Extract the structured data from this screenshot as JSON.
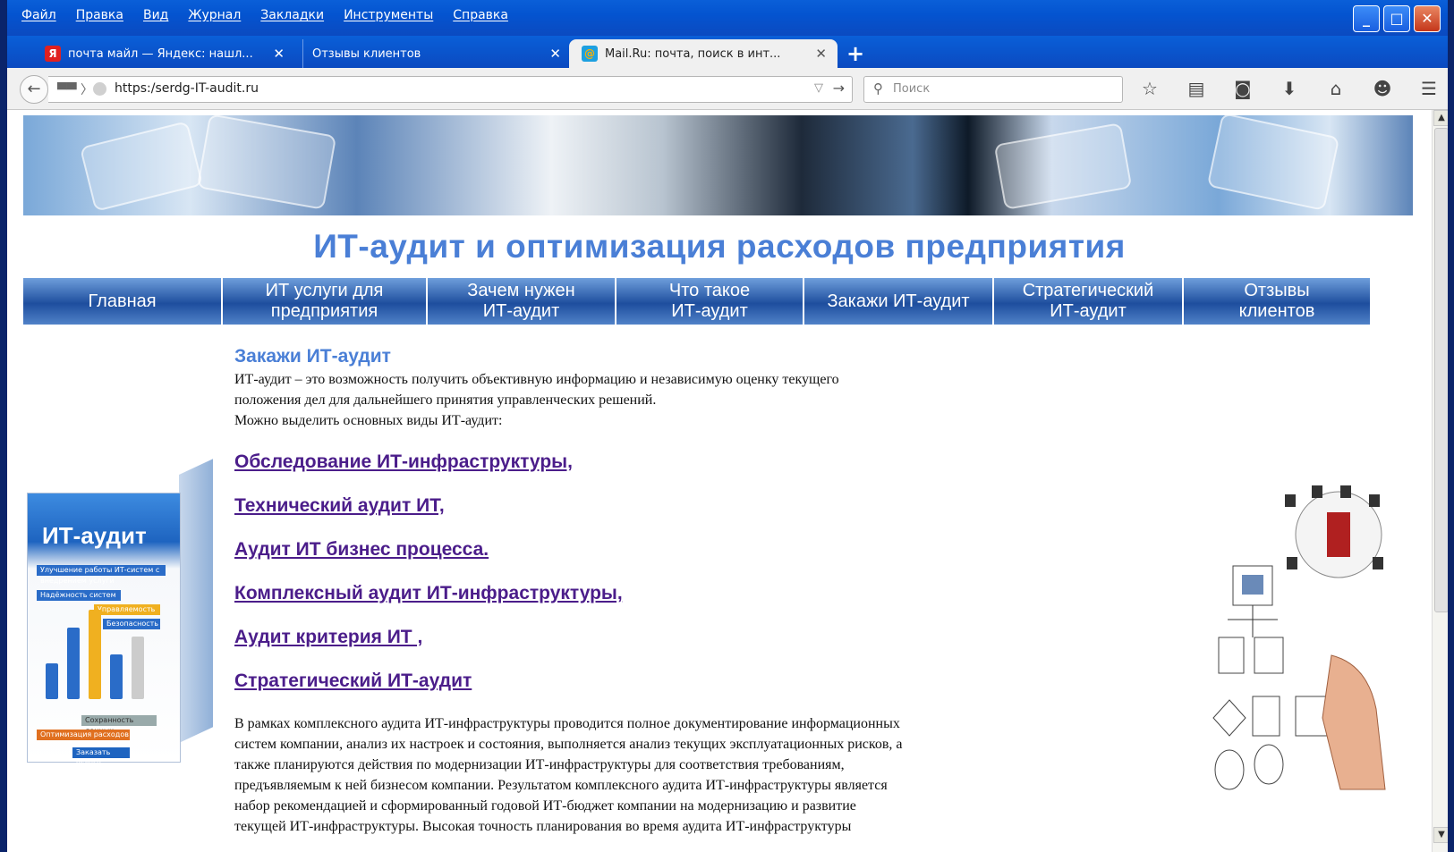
{
  "menu": [
    "Файл",
    "Правка",
    "Вид",
    "Журнал",
    "Закладки",
    "Инструменты",
    "Справка"
  ],
  "tabs": [
    {
      "label": "почта майл — Яндекс: нашл...",
      "favicon": "Я"
    },
    {
      "label": "Отзывы клиентов",
      "favicon": ""
    },
    {
      "label": "Mail.Ru: почта, поиск в инт...",
      "favicon": "@"
    }
  ],
  "navbar": {
    "url": "https:/serdg-IT-audit.ru",
    "search_placeholder": "Поиск"
  },
  "page": {
    "title": "ИТ-аудит и оптимизация расходов предприятия",
    "nav": [
      {
        "l1": "Главная",
        "l2": ""
      },
      {
        "l1": "ИТ услуги для",
        "l2": "предприятия"
      },
      {
        "l1": "Зачем нужен",
        "l2": "ИТ-аудит"
      },
      {
        "l1": "Что такое",
        "l2": "ИТ-аудит"
      },
      {
        "l1": "Закажи ИТ-аудит",
        "l2": ""
      },
      {
        "l1": "Стратегический",
        "l2": "ИТ-аудит"
      },
      {
        "l1": "Отзывы",
        "l2": "клиентов"
      }
    ],
    "section_title": "Закажи ИТ-аудит",
    "intro": [
      "ИТ-аудит – это возможность получить объективную информацию и независимую оценку текущего",
      "положения дел для дальнейшего принятия управленческих решений.",
      "Можно выделить основных виды ИТ-аудит:"
    ],
    "links": [
      "Обследование ИТ-инфраструктуры,",
      "Технический аудит ИТ,",
      "Аудит ИТ бизнес процесса.",
      "Комплексный аудит ИТ-инфраструктуры,",
      "Аудит критерия ИТ ,",
      "Стратегический ИТ-аудит"
    ],
    "body": [
      "В рамках комплексного аудита ИТ-инфраструктуры проводится полное документирование информационных",
      "систем компании, анализ их настроек и состояния, выполняется анализ текущих эксплуатационных рисков, а",
      "также планируются действия по модернизации ИТ-инфраструктуры для соответствия требованиям,",
      "предъявляемым к ней бизнесом компании. Результатом комплексного аудита ИТ-инфраструктуры является",
      "набор рекомендацией и сформированный годовой ИТ-бюджет компании на модернизацию и развитие",
      "текущей ИТ-инфраструктуры. Высокая точность планирования во время аудита ИТ-инфраструктуры"
    ],
    "box": {
      "title": "ИТ-аудит",
      "strips": [
        "Улучшение работы ИТ-систем с внедрением услуги",
        "Надёжность систем",
        "Управляемость",
        "Безопасность"
      ],
      "bottom": [
        "Сохранность данных",
        "Оптимизация расходов",
        "Заказать услугу"
      ]
    }
  },
  "colors": {
    "titlebar": "#0454d0",
    "title_blue": "#4a7fd6",
    "link_purple": "#4b1d8a"
  }
}
